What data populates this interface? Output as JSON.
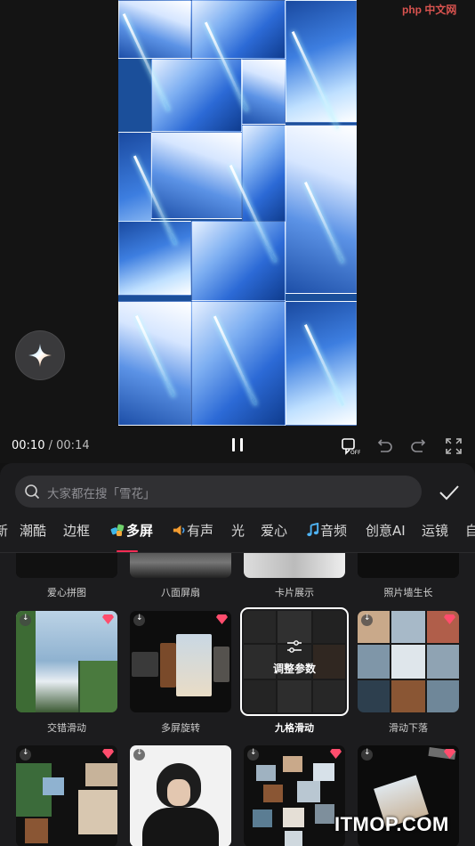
{
  "player": {
    "current_time": "00:10",
    "separator": "/",
    "total_time": "00:14"
  },
  "search": {
    "placeholder": "大家都在搜「雪花」"
  },
  "tabs": [
    {
      "label": "新"
    },
    {
      "label": "潮酷"
    },
    {
      "label": "边框"
    },
    {
      "label": "多屏",
      "active": true
    },
    {
      "label": "有声"
    },
    {
      "label": "光"
    },
    {
      "label": "爱心"
    },
    {
      "label": "音频"
    },
    {
      "label": "创意AI"
    },
    {
      "label": "运镜"
    },
    {
      "label": "自"
    }
  ],
  "effects": {
    "row1": [
      "爱心拼图",
      "八面屏扇",
      "卡片展示",
      "照片墙生长"
    ],
    "row2": [
      "交错滑动",
      "多屏旋转",
      "九格滑动",
      "滑动下落"
    ],
    "selected_overlay": "调整参数",
    "selected": "九格滑动"
  },
  "colors": {
    "accent": "#fe2c55",
    "panel_bg": "#1c1c1e",
    "search_bg": "#303033"
  },
  "watermarks": {
    "bottom": "ITMOP.COM",
    "top": "php 中文网"
  }
}
